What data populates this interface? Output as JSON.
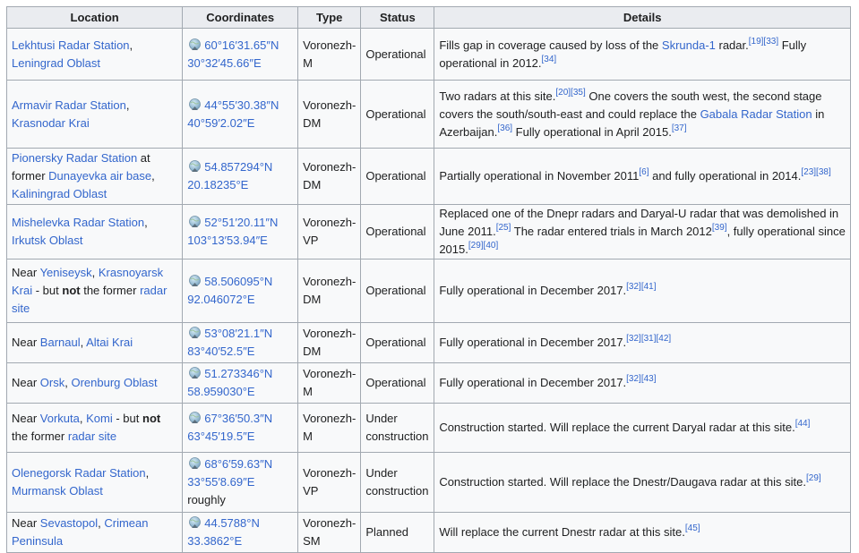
{
  "headers": {
    "location": "Location",
    "coordinates": "Coordinates",
    "type": "Type",
    "status": "Status",
    "details": "Details"
  },
  "rows": [
    {
      "loc": [
        {
          "t": "Lekhtusi Radar Station",
          "l": true
        },
        {
          "t": ", "
        },
        {
          "t": "Leningrad Oblast",
          "l": true
        }
      ],
      "lat": "60°16′31.65″N",
      "lon": "30°32′45.66″E",
      "coordExtra": "",
      "type1": "Voronezh-",
      "type2": "M",
      "status1": "Operational",
      "status2": "",
      "details": [
        {
          "t": "Fills gap in coverage caused by loss of the "
        },
        {
          "t": "Skrunda-1",
          "l": true
        },
        {
          "t": " radar."
        },
        {
          "t": "[19][33]",
          "s": true
        },
        {
          "t": " Fully operational in 2012."
        },
        {
          "t": "[34]",
          "s": true
        }
      ]
    },
    {
      "loc": [
        {
          "t": "Armavir Radar Station",
          "l": true
        },
        {
          "t": ", "
        },
        {
          "t": "Krasnodar Krai",
          "l": true
        }
      ],
      "lat": "44°55′30.38″N",
      "lon": "40°59′2.02″E",
      "coordExtra": "",
      "type1": "Voronezh-",
      "type2": "DM",
      "status1": "Operational",
      "status2": "",
      "details": [
        {
          "t": "Two radars at this site."
        },
        {
          "t": "[20][35]",
          "s": true
        },
        {
          "t": " One covers the south west, the second stage covers the south/south-east and could replace the "
        },
        {
          "t": "Gabala Radar Station",
          "l": true
        },
        {
          "t": " in Azerbaijan."
        },
        {
          "t": "[36]",
          "s": true
        },
        {
          "t": " Fully operational in April 2015."
        },
        {
          "t": "[37]",
          "s": true
        }
      ]
    },
    {
      "loc": [
        {
          "t": "Pionersky Radar Station",
          "l": true
        },
        {
          "t": " at former "
        },
        {
          "t": "Dunayevka air base",
          "l": true
        },
        {
          "t": ", "
        },
        {
          "t": "Kaliningrad Oblast",
          "l": true
        }
      ],
      "lat": "54.857294°N",
      "lon": "20.18235°E",
      "coordExtra": "",
      "type1": "Voronezh-",
      "type2": "DM",
      "status1": "Operational",
      "status2": "",
      "details": [
        {
          "t": "Partially operational in November 2011"
        },
        {
          "t": "[6]",
          "s": true
        },
        {
          "t": " and fully operational in 2014."
        },
        {
          "t": "[23][38]",
          "s": true
        }
      ]
    },
    {
      "loc": [
        {
          "t": "Mishelevka Radar Station",
          "l": true
        },
        {
          "t": ", "
        },
        {
          "t": "Irkutsk Oblast",
          "l": true
        }
      ],
      "lat": "52°51′20.11″N",
      "lon": "103°13′53.94″E",
      "coordExtra": "",
      "type1": "Voronezh-",
      "type2": "VP",
      "status1": "Operational",
      "status2": "",
      "details": [
        {
          "t": "Replaced one of the Dnepr radars and Daryal-U radar that was demolished in June 2011."
        },
        {
          "t": "[25]",
          "s": true
        },
        {
          "t": " The radar entered trials in March 2012"
        },
        {
          "t": "[39]",
          "s": true
        },
        {
          "t": ", fully operational since 2015."
        },
        {
          "t": "[29][40]",
          "s": true
        }
      ]
    },
    {
      "loc": [
        {
          "t": "Near "
        },
        {
          "t": "Yeniseysk",
          "l": true
        },
        {
          "t": ", "
        },
        {
          "t": "Krasnoyarsk Krai",
          "l": true
        },
        {
          "t": " - but "
        },
        {
          "t": "not",
          "b": true
        },
        {
          "t": " the former "
        },
        {
          "t": "radar site",
          "l": true
        }
      ],
      "lat": "58.506095°N",
      "lon": "92.046072°E",
      "coordExtra": "",
      "type1": "Voronezh-",
      "type2": "DM",
      "status1": "Operational",
      "status2": "",
      "details": [
        {
          "t": "Fully operational in December 2017."
        },
        {
          "t": "[32][41]",
          "s": true
        }
      ]
    },
    {
      "loc": [
        {
          "t": "Near "
        },
        {
          "t": "Barnaul",
          "l": true
        },
        {
          "t": ", "
        },
        {
          "t": "Altai Krai",
          "l": true
        }
      ],
      "lat": "53°08′21.1″N",
      "lon": "83°40′52.5″E",
      "coordExtra": "",
      "type1": "Voronezh-",
      "type2": "DM",
      "status1": "Operational",
      "status2": "",
      "details": [
        {
          "t": "Fully operational in December 2017."
        },
        {
          "t": "[32][31][42]",
          "s": true
        }
      ]
    },
    {
      "loc": [
        {
          "t": "Near "
        },
        {
          "t": "Orsk",
          "l": true
        },
        {
          "t": ", "
        },
        {
          "t": "Orenburg Oblast",
          "l": true
        }
      ],
      "lat": "51.273346°N",
      "lon": "58.959030°E",
      "coordExtra": "",
      "type1": "Voronezh-",
      "type2": "M",
      "status1": "Operational",
      "status2": "",
      "details": [
        {
          "t": "Fully operational in December 2017."
        },
        {
          "t": "[32][43]",
          "s": true
        }
      ]
    },
    {
      "loc": [
        {
          "t": "Near "
        },
        {
          "t": "Vorkuta",
          "l": true
        },
        {
          "t": ", "
        },
        {
          "t": "Komi",
          "l": true
        },
        {
          "t": " - but "
        },
        {
          "t": "not",
          "b": true
        },
        {
          "t": " the former "
        },
        {
          "t": "radar site",
          "l": true
        }
      ],
      "lat": "67°36′50.3″N",
      "lon": "63°45′19.5″E",
      "coordExtra": "",
      "type1": "Voronezh-",
      "type2": "M",
      "status1": "Under",
      "status2": "construction",
      "details": [
        {
          "t": "Construction started. Will replace the current Daryal radar at this site."
        },
        {
          "t": "[44]",
          "s": true
        }
      ]
    },
    {
      "loc": [
        {
          "t": "Olenegorsk Radar Station",
          "l": true
        },
        {
          "t": ", "
        },
        {
          "t": "Murmansk Oblast",
          "l": true
        }
      ],
      "lat": "68°6′59.63″N",
      "lon": "33°55′8.69″E",
      "coordExtra": "roughly",
      "type1": "Voronezh-",
      "type2": "VP",
      "status1": "Under",
      "status2": "construction",
      "details": [
        {
          "t": "Construction started. Will replace the Dnestr/Daugava radar at this site."
        },
        {
          "t": "[29]",
          "s": true
        }
      ]
    },
    {
      "loc": [
        {
          "t": "Near "
        },
        {
          "t": "Sevastopol",
          "l": true
        },
        {
          "t": ", "
        },
        {
          "t": "Crimean Peninsula",
          "l": true
        }
      ],
      "lat": "44.5788°N",
      "lon": "33.3862°E",
      "coordExtra": "",
      "type1": "Voronezh-",
      "type2": "SM",
      "status1": "Planned",
      "status2": "",
      "details": [
        {
          "t": "Will replace the current Dnestr radar at this site."
        },
        {
          "t": "[45]",
          "s": true
        }
      ]
    }
  ]
}
